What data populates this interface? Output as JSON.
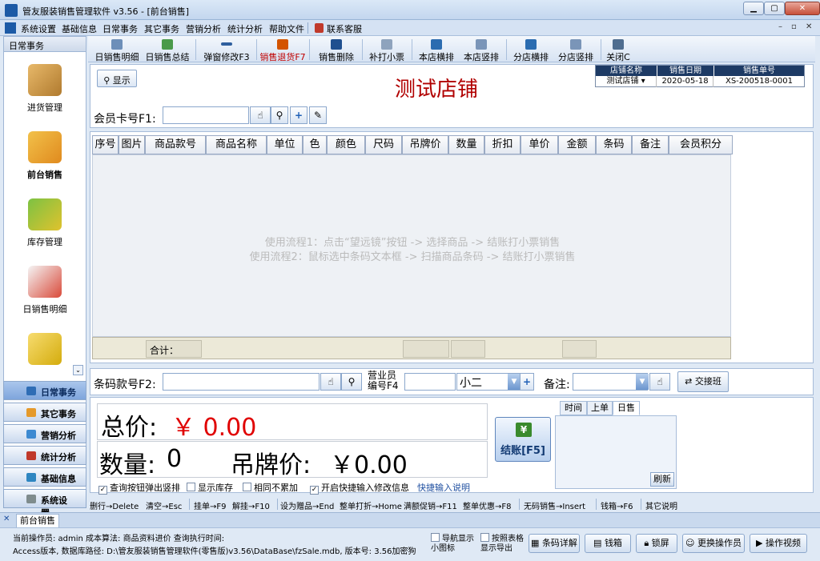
{
  "window": {
    "title": "管友服装销售管理软件 v3.56 - [前台销售]"
  },
  "menu": [
    "系统设置",
    "基础信息",
    "日常事务",
    "其它事务",
    "营销分析",
    "统计分析",
    "帮助文件",
    "联系客服"
  ],
  "left_panel": {
    "header": "日常事务",
    "items": [
      "进货管理",
      "前台销售",
      "库存管理",
      "日销售明细"
    ],
    "nav_buttons": [
      "日常事务",
      "其它事务",
      "营销分析",
      "统计分析",
      "基础信息",
      "系统设置..."
    ]
  },
  "toolbar": [
    "日销售明细",
    "日销售总结",
    "弹窗修改F3",
    "销售退货F7",
    "销售删除",
    "补打小票",
    "本店横排",
    "本店竖排",
    "分店横排",
    "分店竖排",
    "关闭C"
  ],
  "top": {
    "show_button": "显示",
    "store_title": "测试店铺",
    "store_table_headers": [
      "店铺名称",
      "销售日期",
      "销售单号"
    ],
    "store_table_values": [
      "测试店铺",
      "2020-05-18",
      "XS-200518-0001"
    ],
    "member_label": "会员卡号F1:"
  },
  "grid": {
    "columns": [
      "序号",
      "图片",
      "商品款号",
      "商品名称",
      "单位",
      "色",
      "颜色",
      "尺码",
      "吊牌价",
      "数量",
      "折扣",
      "单价",
      "金额",
      "条码",
      "备注",
      "会员积分"
    ],
    "hint1": "使用流程1：点击“望远镜”按钮 -> 选择商品 -> 结账打小票销售",
    "hint2": "使用流程2：鼠标选中条码文本框 -> 扫描商品条码 -> 结账打小票销售",
    "sum_label": "合计："
  },
  "scan": {
    "barcode_label": "条码款号F2:",
    "staff_label_1": "营业员",
    "staff_label_2": "编号F4",
    "staff_value": "小二",
    "remark_label": "备注:",
    "shift_button": "交接班"
  },
  "totals": {
    "total_label": "总价:",
    "total_value": "￥ 0.00",
    "qty_label": "数量:",
    "qty_value": "0",
    "tag_label": "吊牌价:",
    "tag_value": "￥0.00",
    "pay_button": "结账[F5]",
    "tabs": [
      "时间",
      "上单",
      "日售"
    ],
    "refresh": "刷新"
  },
  "options": [
    "查询按钮弹出竖排",
    "显示库存",
    "相同不累加",
    "开启快捷输入修改信息"
  ],
  "options_checked": [
    true,
    false,
    false,
    true
  ],
  "quick_help": "快捷输入说明",
  "shortcuts": [
    "删行→Delete",
    "清空→Esc",
    "挂单→F9",
    "解挂→F10",
    "设为赠品→End",
    "整单打折→Home",
    "满额促销→F11",
    "整单优惠→F8",
    "无码销售→Insert",
    "钱箱→F6",
    "其它说明"
  ],
  "tab_strip": "前台销售",
  "status": {
    "line1": "当前操作员: admin  成本算法: 商品资料进价  查询执行时间:",
    "line2": "Access版本, 数据库路径: D:\\管友服装销售管理软件(零售版)v3.56\\DataBase\\fzSale.mdb, 版本号: 3.56加密狗",
    "check1": "导航显示小图标",
    "check2": "按照表格显示导出",
    "buttons": [
      "条码详解",
      "钱箱",
      "锁屏",
      "更换操作员",
      "操作视频"
    ]
  },
  "colors": {
    "accent": "#1d3a64",
    "title_red": "#b10000",
    "value_red": "#e00000"
  }
}
